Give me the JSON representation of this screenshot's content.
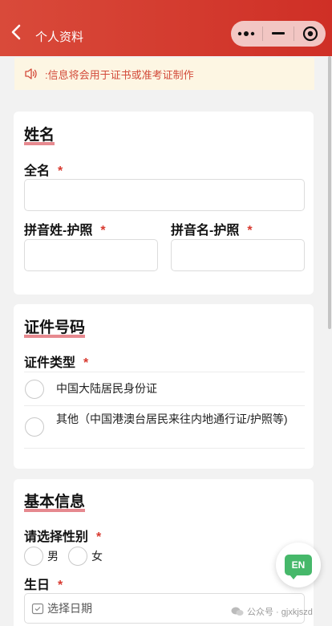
{
  "navbar": {
    "title": "个人资料"
  },
  "notice": {
    "text": ":信息将会用于证书或准考证制作"
  },
  "section_name": {
    "title": "姓名",
    "full_name_label": "全名",
    "pinyin_surname_label": "拼音姓-护照",
    "pinyin_given_label": "拼音名-护照",
    "required_mark": "*"
  },
  "section_id": {
    "title": "证件号码",
    "id_type_label": "证件类型",
    "required_mark": "*",
    "options": [
      "中国大陆居民身份证",
      "其他（中国港澳台居民来往内地通行证/护照等)"
    ]
  },
  "section_basic": {
    "title": "基本信息",
    "gender_label": "请选择性别",
    "required_mark": "*",
    "gender_options": [
      "男",
      "女"
    ],
    "birthday_label": "生日",
    "date_placeholder": "选择日期"
  },
  "fab": {
    "label": "EN"
  },
  "watermark": {
    "text": "公众号 · gjxkjszd"
  },
  "colors": {
    "accent": "#cf2f26",
    "underline": "#e6898f",
    "notice_bg": "#fdf6e3",
    "fab_green": "#46b86a"
  }
}
